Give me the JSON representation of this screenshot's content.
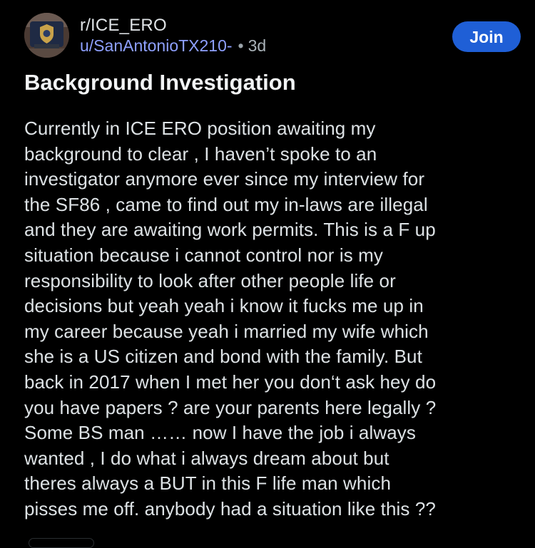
{
  "header": {
    "subreddit": "r/ICE_ERO",
    "username": "u/SanAntonioTX210-",
    "separator": "•",
    "age": "3d",
    "join_label": "Join"
  },
  "post": {
    "title": "Background Investigation",
    "body_lines": [
      "Currently in ICE ERO position awaiting my",
      "background to clear , I haven’t spoke to an",
      "investigator anymore ever since my interview for",
      "the SF86 , came to find out my in-laws are illegal",
      "and they are awaiting work permits. This is a F up",
      "situation because i cannot control nor is my",
      "responsibility to look after other people life or",
      "decisions but yeah yeah i know it fucks me up in",
      "my career because yeah i married my wife which",
      "she is a US citizen and bond with the family. But",
      "back in 2017 when I met her you don‘t ask hey do",
      "you have papers ? are your parents here legally ?",
      "Some BS man …… now I have the job i always",
      "wanted , I do what i always dream about but",
      "theres always a BUT in this F life man which",
      "pisses me off. anybody had a situation like this ??"
    ]
  },
  "colors": {
    "background": "#000000",
    "join_button": "#1f5fd6",
    "username": "#8ea0ff",
    "text": "#dde2e5"
  },
  "icons": {
    "avatar": "subreddit-badge-avatar"
  }
}
